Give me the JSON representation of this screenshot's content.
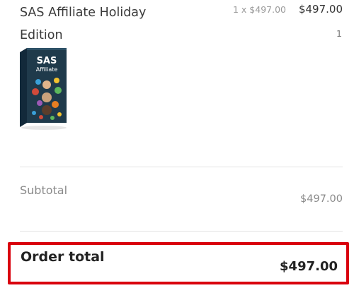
{
  "item": {
    "name": "SAS Affiliate Holiday Edition",
    "unit_price": "1 x $497.00",
    "line_total": "$497.00",
    "quantity": "1",
    "image": {
      "box_title": "SAS",
      "box_subtitle": "Affiliate"
    }
  },
  "summary": {
    "subtotal_label": "Subtotal",
    "subtotal_value": "$497.00",
    "order_total_label": "Order total",
    "order_total_value": "$497.00"
  },
  "colors": {
    "highlight_border": "#d9000d",
    "box_dark": "#1f3a4b"
  }
}
